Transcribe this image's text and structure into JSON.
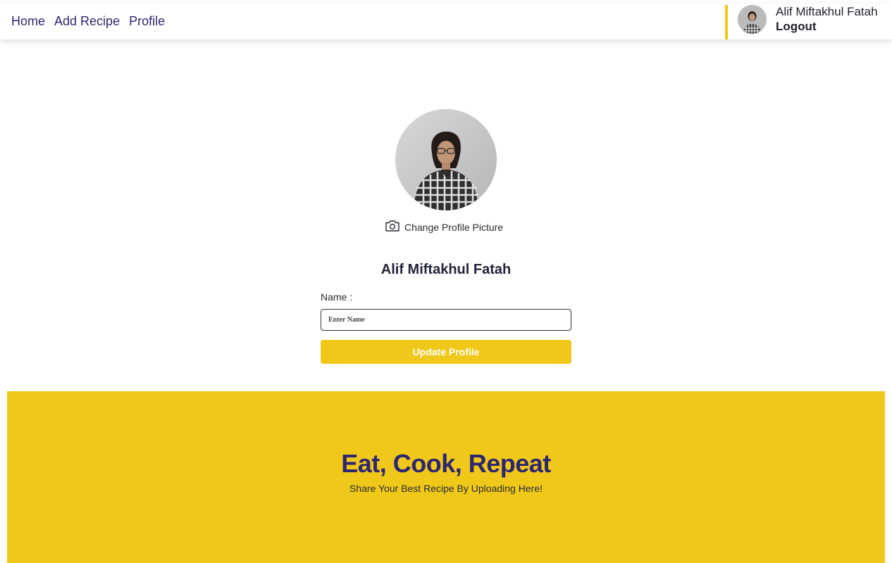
{
  "nav": {
    "items": [
      {
        "label": "Home"
      },
      {
        "label": "Add Recipe"
      },
      {
        "label": "Profile"
      }
    ]
  },
  "user": {
    "name": "Alif Miftakhul Fatah",
    "logout_label": "Logout"
  },
  "profile": {
    "change_picture_label": "Change Profile Picture",
    "name": "Alif Miftakhul Fatah",
    "name_label": "Name :",
    "name_input_placeholder": "Enter Name",
    "name_input_value": "",
    "update_button_label": "Update Profile"
  },
  "footer": {
    "title": "Eat, Cook, Repeat",
    "subtitle": "Share Your Best Recipe By Uploading Here!"
  },
  "colors": {
    "accent": "#efc81a",
    "nav_text": "#2e266f"
  },
  "icons": {
    "change_picture": "camera-icon"
  }
}
